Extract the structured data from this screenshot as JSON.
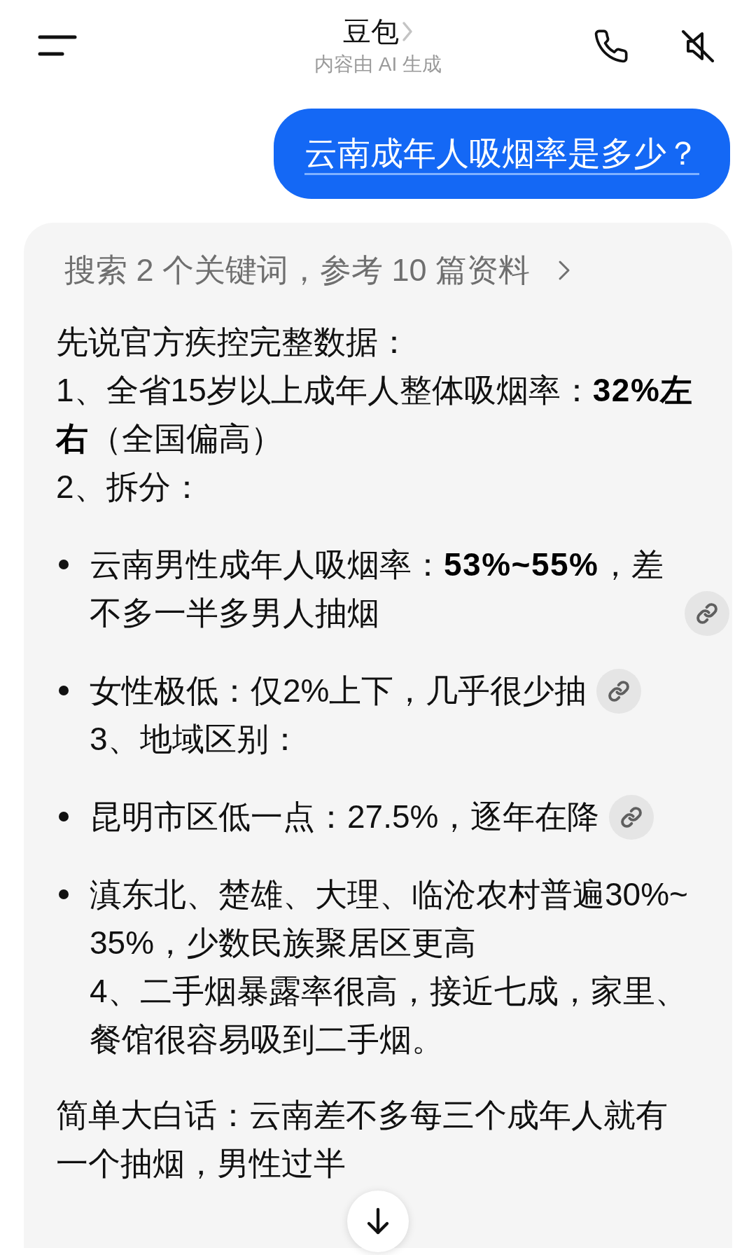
{
  "header": {
    "title": "豆包",
    "subtitle": "内容由 AI 生成"
  },
  "user_message": {
    "text": "云南成年人吸烟率是多少？"
  },
  "answer": {
    "search_summary": "搜索 2 个关键词，参考 10 篇资料",
    "blocks": [
      {
        "kind": "paragraph",
        "lines": [
          "先说官方疾控完整数据：",
          "1、全省15岁以上成年人整体吸烟率：**32%左右**（全国偏高）",
          "2、拆分："
        ]
      },
      {
        "kind": "bullet",
        "lines": [
          "云南男性成年人吸烟率：**53%~55%**，差不多一半多男人抽烟"
        ],
        "citation": true
      },
      {
        "kind": "bullet",
        "lines": [
          "女性极低：仅2%上下，几乎很少抽",
          "3、地域区别："
        ],
        "citation": true
      },
      {
        "kind": "bullet",
        "lines": [
          "昆明市区低一点：27.5%，逐年在降"
        ],
        "citation": true
      },
      {
        "kind": "bullet",
        "lines": [
          "滇东北、楚雄、大理、临沧农村普遍30%~35%，少数民族聚居区更高",
          "4、二手烟暴露率很高，接近七成，家里、餐馆很容易吸到二手烟。"
        ],
        "citation": false
      },
      {
        "kind": "paragraph",
        "lines": [
          "简单大白话：云南差不多每三个成年人就有一个抽烟，男性过半"
        ]
      }
    ]
  }
}
